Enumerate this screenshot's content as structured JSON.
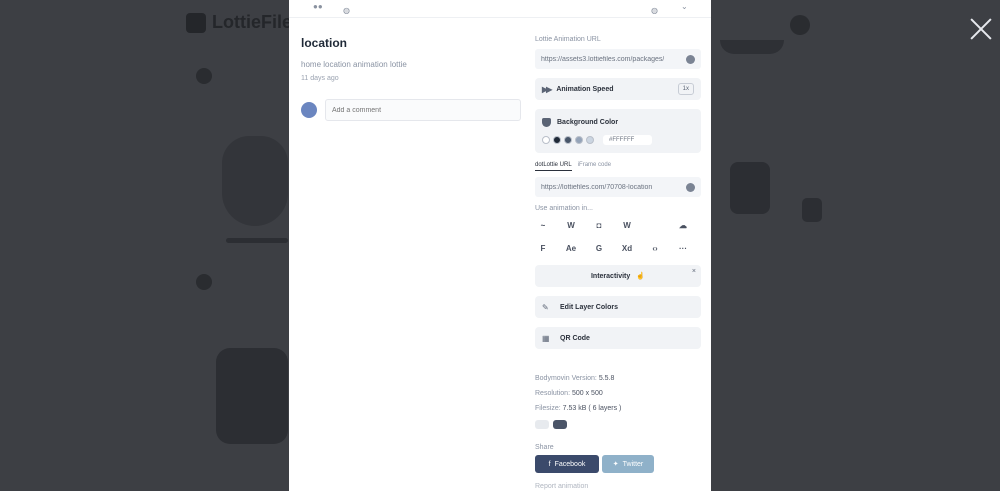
{
  "background": {
    "logo_text": "LottieFiles"
  },
  "modal": {
    "title": "location",
    "description": "home location animation lottie",
    "date": "11 days ago",
    "comment_placeholder": "Add a comment",
    "lottie_url_label": "Lottie Animation URL",
    "lottie_url": "https://assets3.lottiefiles.com/packages/",
    "animation_speed_label": "Animation Speed",
    "animation_speed_value": "1x",
    "background_color_label": "Background Color",
    "background_color_hex": "#FFFFFF",
    "swatches": [
      "#ffffff",
      "#1f2937",
      "#475569",
      "#94a3b8",
      "#cbd5e1"
    ],
    "tabs": [
      "dotLottie URL",
      "iFrame code"
    ],
    "embed_url": "https://lottiefiles.com/70708-location",
    "use_animation_label": "Use animation in...",
    "apps": [
      {
        "name": "webflow",
        "glyph": "~"
      },
      {
        "name": "wordpress",
        "glyph": "W"
      },
      {
        "name": "dropbox",
        "glyph": "◘"
      },
      {
        "name": "wix",
        "glyph": "W"
      },
      {
        "name": "apple",
        "glyph": ""
      },
      {
        "name": "cloud",
        "glyph": "☁"
      },
      {
        "name": "framer",
        "glyph": "F"
      },
      {
        "name": "after-effects",
        "glyph": "Ae"
      },
      {
        "name": "google",
        "glyph": "G"
      },
      {
        "name": "xd",
        "glyph": "Xd"
      },
      {
        "name": "vscode",
        "glyph": "‹›"
      },
      {
        "name": "more",
        "glyph": "···"
      }
    ],
    "interactivity_label": "Interactivity",
    "edit_layer_colors_label": "Edit Layer Colors",
    "qr_code_label": "QR Code",
    "bodymovin_label": "Bodymovin Version:",
    "bodymovin_value": "5.5.8",
    "resolution_label": "Resolution:",
    "resolution_value": "500 x 500",
    "filesize_label": "Filesize:",
    "filesize_value": "7.53 kB ( 6 layers )",
    "share_label": "Share",
    "facebook_label": "Facebook",
    "twitter_label": "Twitter",
    "report_label": "Report animation"
  }
}
